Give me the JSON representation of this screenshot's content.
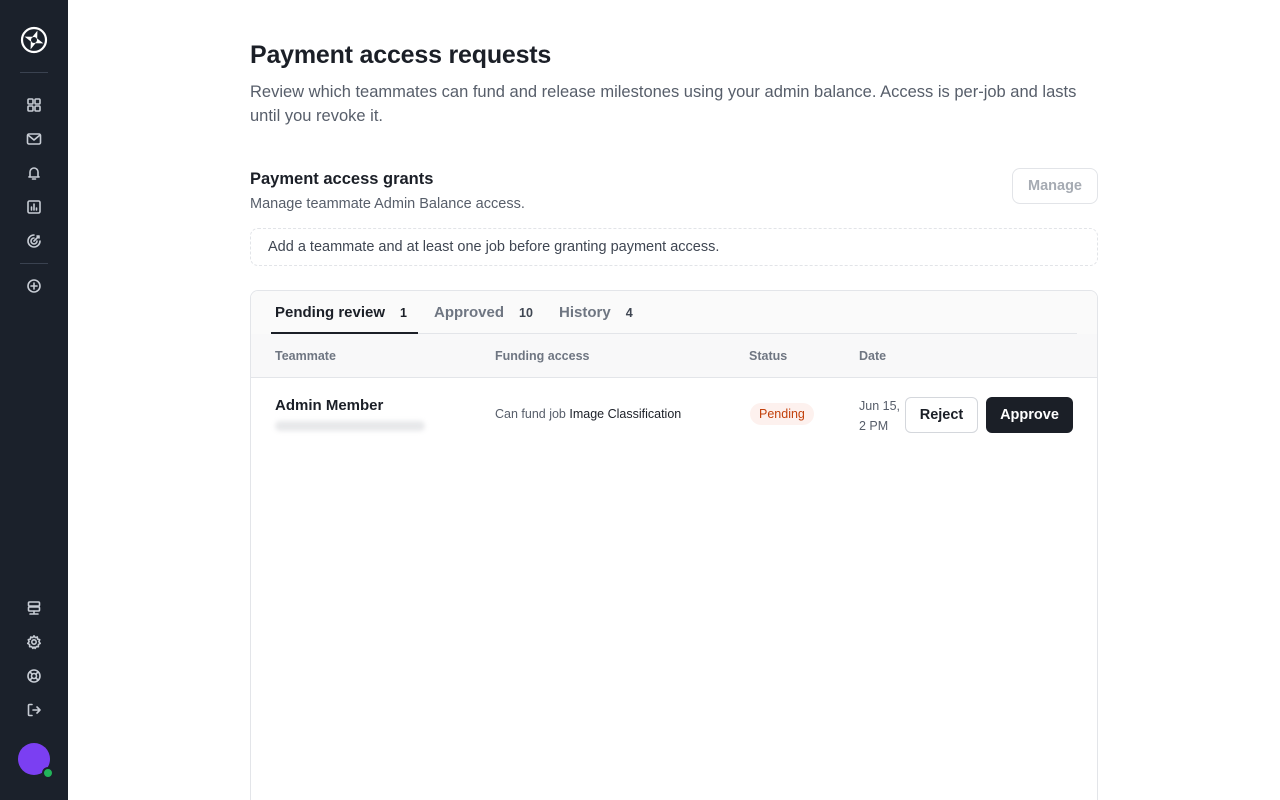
{
  "sidebar": {
    "logo_icon": "aperture-logo-icon",
    "nav": [
      {
        "icon": "grid-icon",
        "name": "sidebar-item-dashboard"
      },
      {
        "icon": "mail-icon",
        "name": "sidebar-item-messages"
      },
      {
        "icon": "bell-icon",
        "name": "sidebar-item-notifications"
      },
      {
        "icon": "bar-chart-icon",
        "name": "sidebar-item-reports"
      },
      {
        "icon": "target-icon",
        "name": "sidebar-item-goals"
      },
      {
        "icon": "plus-circle-icon",
        "name": "sidebar-item-create"
      }
    ],
    "bottom_nav": [
      {
        "icon": "database-icon",
        "name": "sidebar-item-storage"
      },
      {
        "icon": "gear-icon",
        "name": "sidebar-item-settings"
      },
      {
        "icon": "lifebuoy-icon",
        "name": "sidebar-item-support"
      },
      {
        "icon": "logout-icon",
        "name": "sidebar-item-logout"
      }
    ],
    "avatar_color": "#7b3ff2",
    "online_color": "#22b45a"
  },
  "header": {
    "title": "Payment access requests",
    "description": "Review which teammates can fund and release milestones using your admin balance. Access is per-job and lasts until you revoke it."
  },
  "grants": {
    "title": "Payment access grants",
    "subtitle": "Manage teammate Admin Balance access.",
    "manage_label": "Manage",
    "notice": "Add a teammate and at least one job before granting payment access."
  },
  "tabs": [
    {
      "label": "Pending review",
      "count": "1",
      "active": true
    },
    {
      "label": "Approved",
      "count": "10",
      "active": false
    },
    {
      "label": "History",
      "count": "4",
      "active": false
    }
  ],
  "table": {
    "columns": [
      "Teammate",
      "Funding access",
      "Status",
      "Date"
    ],
    "rows": [
      {
        "teammate": "Admin Member",
        "funding_prefix": "Can fund job",
        "funding_job": "Image Classification",
        "status": "Pending",
        "date": "Jun 15, 2 PM",
        "reject_label": "Reject",
        "approve_label": "Approve"
      }
    ]
  },
  "colors": {
    "sidebar_bg": "#1b212b",
    "primary": "#1b1f27",
    "pending_text": "#c2410c",
    "pending_bg": "#fdf1ee"
  }
}
